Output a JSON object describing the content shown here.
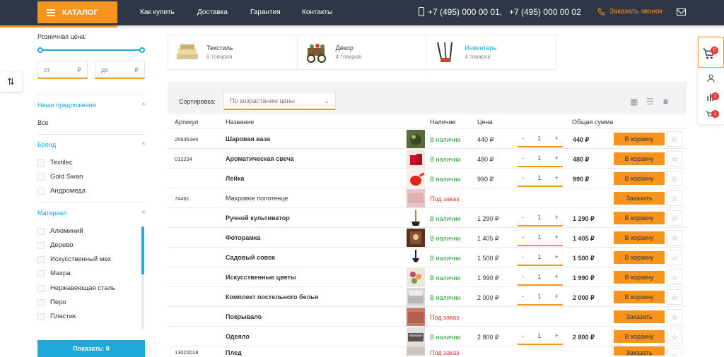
{
  "header": {
    "catalog_label": "КАТАЛОГ",
    "nav": [
      "Как купить",
      "Доставка",
      "Гарантия",
      "Контакты"
    ],
    "phone1": "+7 (495) 000 00 01,",
    "phone2": "+7 (495) 000 00 02",
    "callback_label": "Заказать звонок"
  },
  "sidebar": {
    "price_label": "Розничная цена:",
    "price_from": "от",
    "price_to": "до",
    "currency": "₽",
    "offers_title": "Наши предложения",
    "offers_value": "Все",
    "brand_title": "Бренд",
    "brands": [
      "Textilec",
      "Gold Swan",
      "Андромеда"
    ],
    "material_title": "Материал",
    "materials": [
      "Алюминий",
      "Дерево",
      "Искусственный мех",
      "Махра",
      "Нержавеющая сталь",
      "Перо",
      "Пластик"
    ],
    "show_label": "Показать: 0"
  },
  "categories": [
    {
      "name": "Текстиль",
      "count": "6 товаров"
    },
    {
      "name": "Декор",
      "count": "4 товаров"
    },
    {
      "name": "Инвентарь",
      "count": "4 товаров"
    }
  ],
  "sort": {
    "label": "Сортировка:",
    "selected": "По возрастанию цены"
  },
  "table": {
    "headers": {
      "sku": "Артикул",
      "name": "Название",
      "stock": "Наличие",
      "price": "Цена",
      "total": "Общая сумма"
    },
    "rows": [
      {
        "sku": "256453e6",
        "name": "Шаровая ваза",
        "stock": "В наличии",
        "price": "440 ₽",
        "qty": "1",
        "total": "440 ₽",
        "action": "В корзину"
      },
      {
        "sku": "012234",
        "name": "Ароматическая свеча",
        "stock": "В наличии",
        "price": "480 ₽",
        "qty": "1",
        "total": "480 ₽",
        "action": "В корзину"
      },
      {
        "sku": "",
        "name": "Лейка",
        "stock": "В наличии",
        "price": "990 ₽",
        "qty": "1",
        "total": "990 ₽",
        "action": "В корзину"
      },
      {
        "sku": "74461",
        "name": "Махровое полотенце",
        "stock": "Под заказ",
        "price": "",
        "qty": "",
        "total": "",
        "action": "Заказать"
      },
      {
        "sku": "",
        "name": "Ручной культиватор",
        "stock": "В наличии",
        "price": "1 290 ₽",
        "qty": "1",
        "total": "1 290 ₽",
        "action": "В корзину"
      },
      {
        "sku": "",
        "name": "Фоторамка",
        "stock": "В наличии",
        "price": "1 405 ₽",
        "qty": "1",
        "total": "1 405 ₽",
        "action": "В корзину"
      },
      {
        "sku": "",
        "name": "Садовый совок",
        "stock": "В наличии",
        "price": "1 500 ₽",
        "qty": "1",
        "total": "1 500 ₽",
        "action": "В корзину"
      },
      {
        "sku": "",
        "name": "Искусственные цветы",
        "stock": "В наличии",
        "price": "1 990 ₽",
        "qty": "1",
        "total": "1 990 ₽",
        "action": "В корзину"
      },
      {
        "sku": "",
        "name": "Комплект постельного белья",
        "stock": "В наличии",
        "price": "2 000 ₽",
        "qty": "1",
        "total": "2 000 ₽",
        "action": "В корзину"
      },
      {
        "sku": "",
        "name": "Покрывало",
        "stock": "Под заказ",
        "price": "",
        "qty": "",
        "total": "",
        "action": "Заказать"
      },
      {
        "sku": "",
        "name": "Одеяло",
        "stock": "В наличии",
        "price": "2 800 ₽",
        "qty": "1",
        "total": "2 800 ₽",
        "action": "В корзину"
      },
      {
        "sku": "13022018",
        "name": "Плед",
        "stock": "Под заказ",
        "price": "",
        "qty": "",
        "total": "",
        "action": "Заказать"
      }
    ]
  },
  "right_panel": {
    "cart_count": "0",
    "compare_count": "1",
    "favorites_count": "1"
  }
}
